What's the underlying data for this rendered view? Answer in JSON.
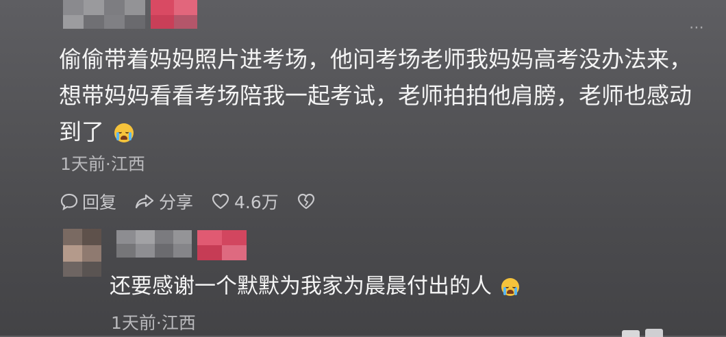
{
  "comment": {
    "text": "偷偷带着妈妈照片进考场，他问考场老师我妈妈高考没办法来，想带妈妈看看考场陪我一起考试，老师拍拍他肩膀，老师也感动到了",
    "emoji": "crying-face",
    "time": "1天前",
    "location": "江西"
  },
  "actions": {
    "reply": "回复",
    "share": "分享",
    "like_count": "4.6万"
  },
  "reply": {
    "text": "还要感谢一个默默为我家为晨晨付出的人",
    "emoji": "crying-face",
    "time": "1天前",
    "location": "江西"
  },
  "colors": {
    "background": "#55555a",
    "badge": "#e0405a",
    "emoji": "#f5c33b"
  }
}
